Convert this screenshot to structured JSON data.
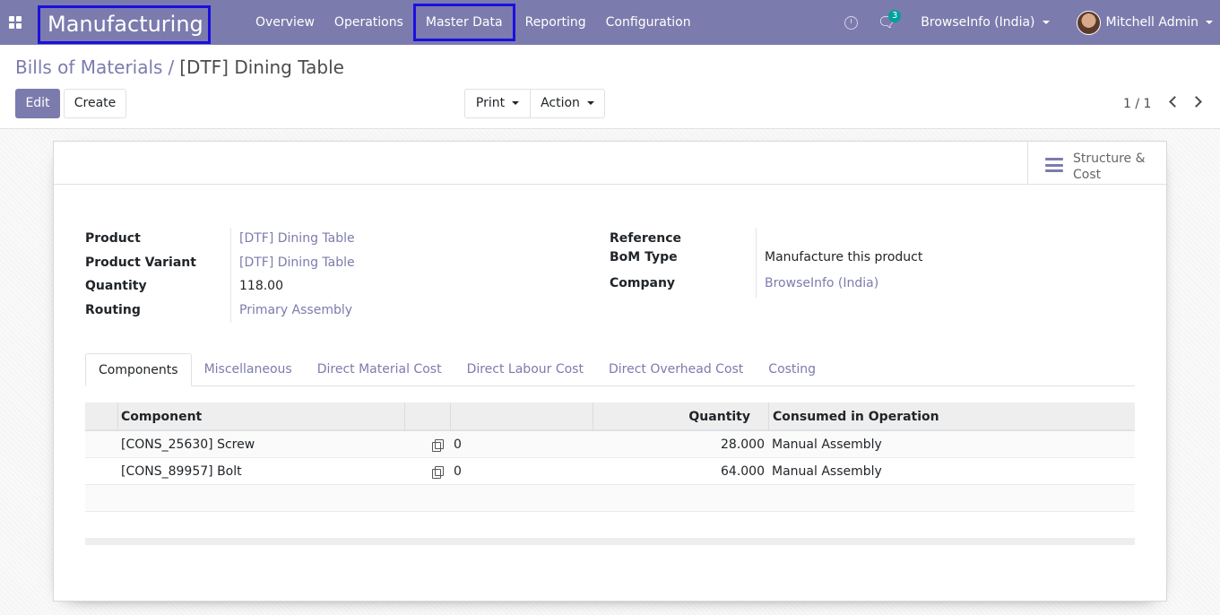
{
  "navbar": {
    "app_title": "Manufacturing",
    "menu": [
      "Overview",
      "Operations",
      "Master Data",
      "Reporting",
      "Configuration"
    ],
    "messages_count": "3",
    "company": "BrowseInfo (India)",
    "user": "Mitchell Admin",
    "icons": {
      "apps": "apps-grid-icon",
      "activity": "clock-icon",
      "messages": "chat-icon"
    },
    "highlight_color": "#1a0fe0",
    "brand_color": "#7c7bad"
  },
  "control_panel": {
    "breadcrumb_parent": "Bills of Materials",
    "breadcrumb_separator": "/",
    "breadcrumb_current": "[DTF] Dining Table",
    "edit_label": "Edit",
    "create_label": "Create",
    "print_label": "Print",
    "action_label": "Action",
    "pager": "1 / 1"
  },
  "smart_button": {
    "line1": "Structure &",
    "line2": "Cost",
    "icon": "bars-icon"
  },
  "fields_left": {
    "product_label": "Product",
    "product_value": "[DTF] Dining Table",
    "variant_label": "Product Variant",
    "variant_value": "[DTF] Dining Table",
    "quantity_label": "Quantity",
    "quantity_value": "118.00",
    "routing_label": "Routing",
    "routing_value": "Primary Assembly"
  },
  "fields_right": {
    "reference_label": "Reference",
    "reference_value": "",
    "bom_type_label": "BoM Type",
    "bom_type_value": "Manufacture this product",
    "company_label": "Company",
    "company_value": "BrowseInfo (India)"
  },
  "tabs": [
    "Components",
    "Miscellaneous",
    "Direct Material Cost",
    "Direct Labour Cost",
    "Direct Overhead Cost",
    "Costing"
  ],
  "components_table": {
    "headers": {
      "component": "Component",
      "quantity": "Quantity",
      "operation": "Consumed in Operation"
    },
    "rows": [
      {
        "component": "[CONS_25630] Screw",
        "variants": "0",
        "quantity": "28.000",
        "operation": "Manual Assembly"
      },
      {
        "component": "[CONS_89957] Bolt",
        "variants": "0",
        "quantity": "64.000",
        "operation": "Manual Assembly"
      }
    ]
  }
}
